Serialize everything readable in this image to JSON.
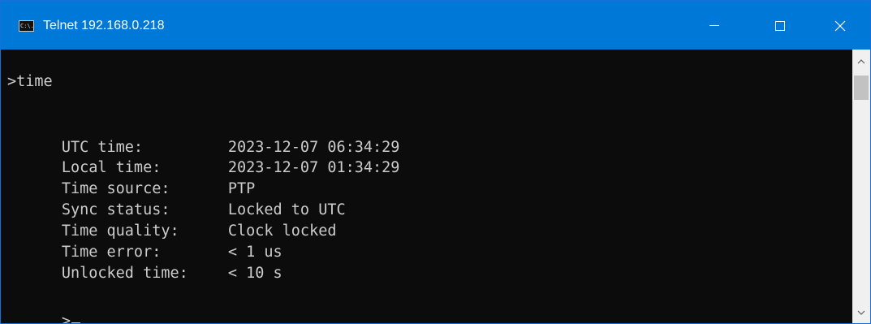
{
  "window": {
    "title": "Telnet 192.168.0.218",
    "icon": "console-icon",
    "icon_text": "C:\\."
  },
  "terminal": {
    "command_line": ">time",
    "rows": [
      {
        "label": "UTC time:",
        "value": "2023-12-07 06:34:29"
      },
      {
        "label": "Local time:",
        "value": "2023-12-07 01:34:29"
      },
      {
        "label": "Time source:",
        "value": "PTP"
      },
      {
        "label": "Sync status:",
        "value": "Locked to UTC"
      },
      {
        "label": "Time quality:",
        "value": "Clock locked"
      },
      {
        "label": "Time error:",
        "value": "< 1 us"
      },
      {
        "label": "Unlocked time:",
        "value": "< 10 s"
      }
    ],
    "prompt": ">"
  },
  "colors": {
    "titlebar": "#0078d7",
    "terminal_bg": "#0c0c0c",
    "terminal_fg": "#cccccc"
  }
}
